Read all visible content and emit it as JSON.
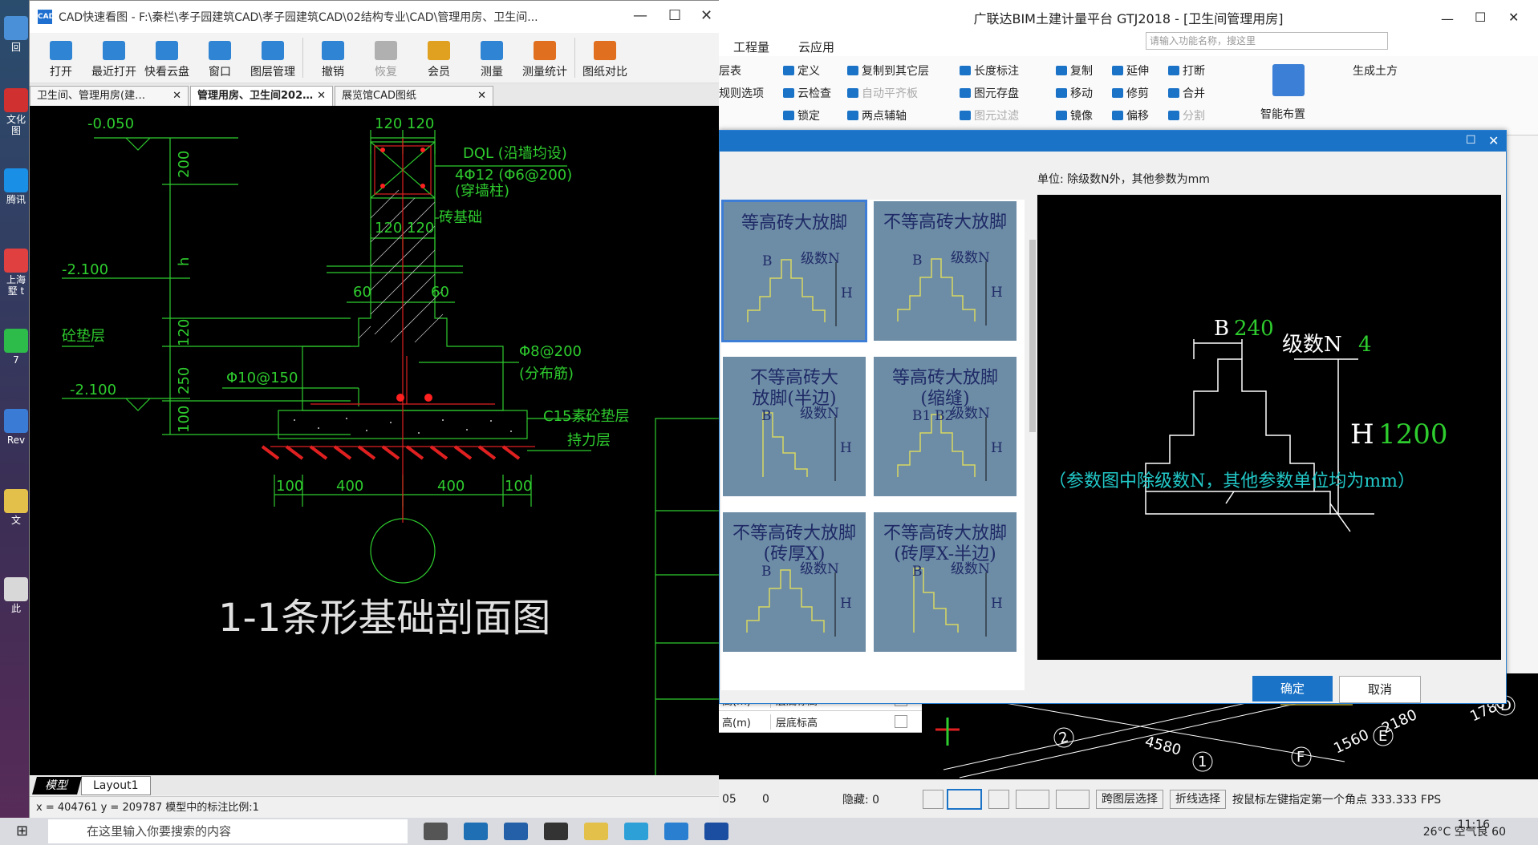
{
  "desktop": {
    "icons": [
      {
        "label": "回",
        "color": "#4a90d9"
      },
      {
        "label": "文化\n图",
        "color": "#d03030"
      },
      {
        "label": "腾讯",
        "color": "#1a8fe6"
      },
      {
        "label": "上海\n墅 t",
        "color": "#e04040"
      },
      {
        "label": "7",
        "color": "#2dbb4a"
      },
      {
        "label": "Rev",
        "color": "#3a7bd5"
      },
      {
        "label": "文",
        "color": "#e3c04a"
      },
      {
        "label": "此",
        "color": "#d8d8d8"
      }
    ]
  },
  "cad": {
    "title": "CAD快速看图 - F:\\秦栏\\孝子园建筑CAD\\孝子园建筑CAD\\02结构专业\\CAD\\管理用房、卫生间...",
    "toolbar": [
      {
        "label": "打开",
        "icon": "folder-open-icon",
        "color": "#2f84d4"
      },
      {
        "label": "最近打开",
        "icon": "clock-icon",
        "color": "#2f84d4"
      },
      {
        "label": "快看云盘",
        "icon": "cloud-icon",
        "color": "#2f84d4"
      },
      {
        "label": "窗口",
        "icon": "window-icon",
        "color": "#2f84d4"
      },
      {
        "label": "图层管理",
        "icon": "layers-icon",
        "color": "#2f84d4"
      },
      {
        "label": "撤销",
        "icon": "undo-icon",
        "color": "#2f84d4"
      },
      {
        "label": "恢复",
        "icon": "redo-icon",
        "color": "#b0b0b0"
      },
      {
        "label": "会员",
        "icon": "vip-icon",
        "color": "#e0a020"
      },
      {
        "label": "测量",
        "icon": "ruler-icon",
        "color": "#2f84d4"
      },
      {
        "label": "测量统计",
        "icon": "chart-icon",
        "color": "#e07020"
      },
      {
        "label": "图纸对比",
        "icon": "compare-icon",
        "color": "#e07020"
      }
    ],
    "tabs": [
      {
        "label": "卫生间、管理用房(建…",
        "active": false
      },
      {
        "label": "管理用房、卫生间202…",
        "active": true
      },
      {
        "label": "展览馆CAD图纸",
        "active": false
      }
    ],
    "layout_tabs": [
      "模型",
      "Layout1"
    ],
    "status": "x = 404761  y = 209787  模型中的标注比例:1",
    "drawing": {
      "title": "1-1条形基础剖面图",
      "labels": {
        "elev1": "-0.050",
        "elev2": "-2.100",
        "elev3": "-2.100",
        "left_note": "砼垫层",
        "dql": "DQL (沿墙均设)",
        "rebar1": "4Φ12 (Φ6@200)",
        "rebar1b": "(穿墙柱)",
        "brick": "砖基础",
        "phi8": "Φ8@200",
        "phi8b": "(分布筋)",
        "phi10": "Φ10@150",
        "c15": "C15素砼垫层",
        "bearing": "持力层",
        "d120a": "120",
        "d120b": "120",
        "d120c": "120",
        "d120d": "120",
        "d60a": "60",
        "d60b": "60",
        "d100a": "100",
        "d400a": "400",
        "d400b": "400",
        "d100b": "100",
        "v200": "200",
        "vh": "h",
        "v120": "120",
        "v250": "250",
        "v100": "100"
      }
    }
  },
  "gtj": {
    "title": "广联达BIM土建计量平台 GTJ2018 - [卫生间管理用房]",
    "menu": [
      "工程量",
      "云应用"
    ],
    "search_placeholder": "请输入功能名称，搜这里",
    "ribbon": {
      "col0": [
        "层表",
        "规则选项"
      ],
      "col1": [
        "定义",
        "云检查",
        "锁定"
      ],
      "col2": [
        "复制到其它层",
        "自动平齐板",
        "两点辅轴"
      ],
      "col3": [
        "长度标注",
        "图元存盘",
        "图元过滤"
      ],
      "col4": [
        "复制",
        "移动",
        "镜像"
      ],
      "col5": [
        "延伸",
        "修剪",
        "偏移"
      ],
      "col6": [
        "打断",
        "合并",
        "分割"
      ],
      "smart": "智能布置",
      "earth": "生成土方"
    },
    "props": [
      {
        "name": "高(m)",
        "value": "层底标高"
      },
      {
        "name": "高(m)",
        "value": "层底标高"
      }
    ],
    "status": {
      "a": "05",
      "b": "0",
      "hidden": "隐藏: 0",
      "btn1": "跨图层选择",
      "btn2": "折线选择",
      "hint": "按鼠标左键指定第一个角点 333.333 FPS"
    },
    "grid_labels": [
      "4580",
      "1560",
      "2180",
      "1780",
      "2",
      "1",
      "F",
      "E",
      "D"
    ]
  },
  "dialog": {
    "unit": "单位:   除级数N外，其他参数为mm",
    "thumbs": [
      {
        "title": "等高砖大放脚",
        "selected": true
      },
      {
        "title": "不等高砖大放脚",
        "selected": false
      },
      {
        "title": "不等高砖大\n放脚(半边)",
        "selected": false
      },
      {
        "title": "等高砖大放脚\n(缩缝)",
        "selected": false
      },
      {
        "title": "不等高砖大放脚\n(砖厚X)",
        "selected": false
      },
      {
        "title": "不等高砖大放脚\n(砖厚X-半边)",
        "selected": false
      }
    ],
    "thumb_labels": {
      "b": "B",
      "n": "级数N",
      "h": "H",
      "b1": "B1",
      "b2": "B2"
    },
    "preview": {
      "b_label": "B",
      "b_value": "240",
      "n_label": "级数N",
      "n_value": "4",
      "h_label": "H",
      "h_value": "1200",
      "note": "（参数图中除级数N，其他参数单位均为mm）"
    },
    "ok": "确定",
    "cancel": "取消"
  },
  "taskbar": {
    "search": "在这里输入你要搜索的内容",
    "weather": "26°C  空气良 60",
    "time": "11:16"
  }
}
